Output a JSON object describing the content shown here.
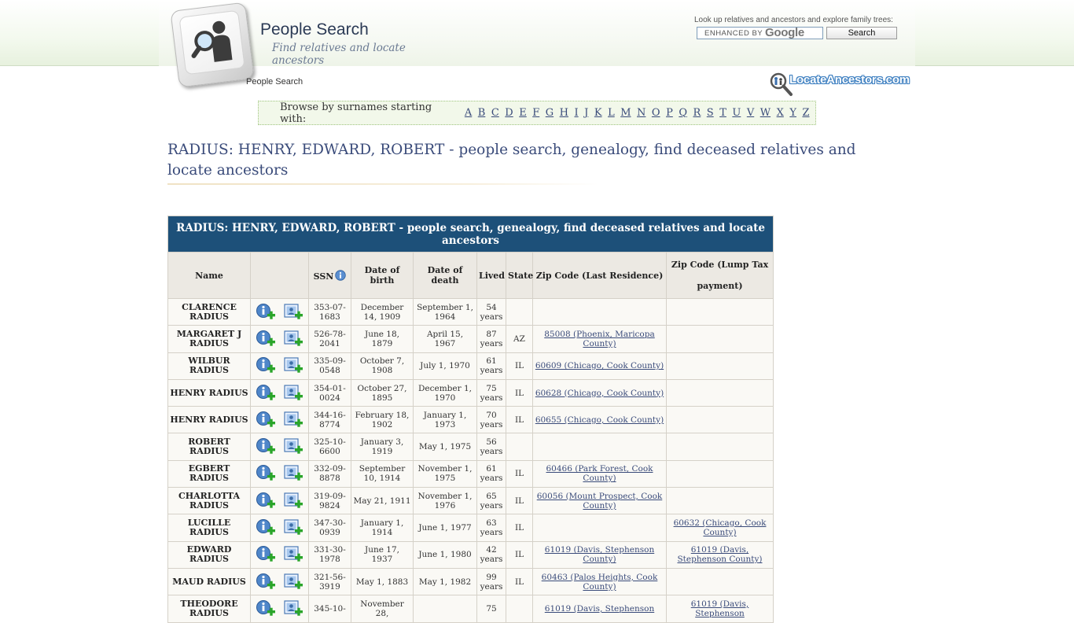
{
  "header": {
    "site_title": "People Search",
    "tagline": "Find relatives and locate ancestors",
    "search_hint": "Look up relatives and ancestors and explore family trees:",
    "search_placeholder_enhanced": "ENHANCED BY",
    "search_placeholder_brand": "Google",
    "search_button": "Search",
    "breadcrumb": "People Search",
    "partner_logo": "LocateAncestors.com"
  },
  "alphabet": {
    "label": "Browse by surnames starting with:",
    "letters": [
      "A",
      "B",
      "C",
      "D",
      "E",
      "F",
      "G",
      "H",
      "I",
      "J",
      "K",
      "L",
      "M",
      "N",
      "O",
      "P",
      "Q",
      "R",
      "S",
      "T",
      "U",
      "V",
      "W",
      "X",
      "Y",
      "Z"
    ]
  },
  "page": {
    "heading": "RADIUS: HENRY, EDWARD, ROBERT - people search, genealogy, find deceased relatives and locate ancestors"
  },
  "table": {
    "caption": "RADIUS: HENRY, EDWARD, ROBERT - people search, genealogy, find deceased relatives and locate ancestors",
    "columns": {
      "name": "Name",
      "actions": "",
      "ssn": "SSN",
      "dob": "Date of birth",
      "dod": "Date of death",
      "lived": "Lived",
      "state": "State",
      "zip_last": "Zip Code (Last Residence)",
      "zip_lump": "Zip Code (Lump Tax payment)"
    },
    "icons": {
      "details": "info-plus-icon",
      "add": "add-to-tree-icon",
      "ssn_info": "info-icon"
    },
    "rows": [
      {
        "name": "CLARENCE RADIUS",
        "ssn": "353-07-1683",
        "dob": "December 14, 1909",
        "dod": "September 1, 1964",
        "lived": "54 years",
        "state": "",
        "zip_last": "",
        "zip_lump": ""
      },
      {
        "name": "MARGARET J RADIUS",
        "ssn": "526-78-2041",
        "dob": "June 18, 1879",
        "dod": "April 15, 1967",
        "lived": "87 years",
        "state": "AZ",
        "zip_last": "85008 (Phoenix, Maricopa County)",
        "zip_lump": ""
      },
      {
        "name": "WILBUR RADIUS",
        "ssn": "335-09-0548",
        "dob": "October 7, 1908",
        "dod": "July 1, 1970",
        "lived": "61 years",
        "state": "IL",
        "zip_last": "60609 (Chicago, Cook County)",
        "zip_lump": ""
      },
      {
        "name": "HENRY RADIUS",
        "ssn": "354-01-0024",
        "dob": "October 27, 1895",
        "dod": "December 1, 1970",
        "lived": "75 years",
        "state": "IL",
        "zip_last": "60628 (Chicago, Cook County)",
        "zip_lump": ""
      },
      {
        "name": "HENRY RADIUS",
        "ssn": "344-16-8774",
        "dob": "February 18, 1902",
        "dod": "January 1, 1973",
        "lived": "70 years",
        "state": "IL",
        "zip_last": "60655 (Chicago, Cook County)",
        "zip_lump": ""
      },
      {
        "name": "ROBERT RADIUS",
        "ssn": "325-10-6600",
        "dob": "January 3, 1919",
        "dod": "May 1, 1975",
        "lived": "56 years",
        "state": "",
        "zip_last": "",
        "zip_lump": ""
      },
      {
        "name": "EGBERT RADIUS",
        "ssn": "332-09-8878",
        "dob": "September 10, 1914",
        "dod": "November 1, 1975",
        "lived": "61 years",
        "state": "IL",
        "zip_last": "60466 (Park Forest, Cook County)",
        "zip_lump": ""
      },
      {
        "name": "CHARLOTTA RADIUS",
        "ssn": "319-09-9824",
        "dob": "May 21, 1911",
        "dod": "November 1, 1976",
        "lived": "65 years",
        "state": "IL",
        "zip_last": "60056 (Mount Prospect, Cook County)",
        "zip_lump": ""
      },
      {
        "name": "LUCILLE RADIUS",
        "ssn": "347-30-0939",
        "dob": "January 1, 1914",
        "dod": "June 1, 1977",
        "lived": "63 years",
        "state": "IL",
        "zip_last": "",
        "zip_lump": "60632 (Chicago, Cook County)"
      },
      {
        "name": "EDWARD RADIUS",
        "ssn": "331-30-1978",
        "dob": "June 17, 1937",
        "dod": "June 1, 1980",
        "lived": "42 years",
        "state": "IL",
        "zip_last": "61019 (Davis, Stephenson County)",
        "zip_lump": "61019 (Davis, Stephenson County)"
      },
      {
        "name": "MAUD RADIUS",
        "ssn": "321-56-3919",
        "dob": "May 1, 1883",
        "dod": "May 1, 1982",
        "lived": "99 years",
        "state": "IL",
        "zip_last": "60463 (Palos Heights, Cook County)",
        "zip_lump": ""
      },
      {
        "name": "THEODORE RADIUS",
        "ssn": "345-10-",
        "dob": "November 28,",
        "dod": "",
        "lived": "75",
        "state": "",
        "zip_last": "61019 (Davis, Stephenson",
        "zip_lump": "61019 (Davis, Stephenson"
      }
    ]
  }
}
